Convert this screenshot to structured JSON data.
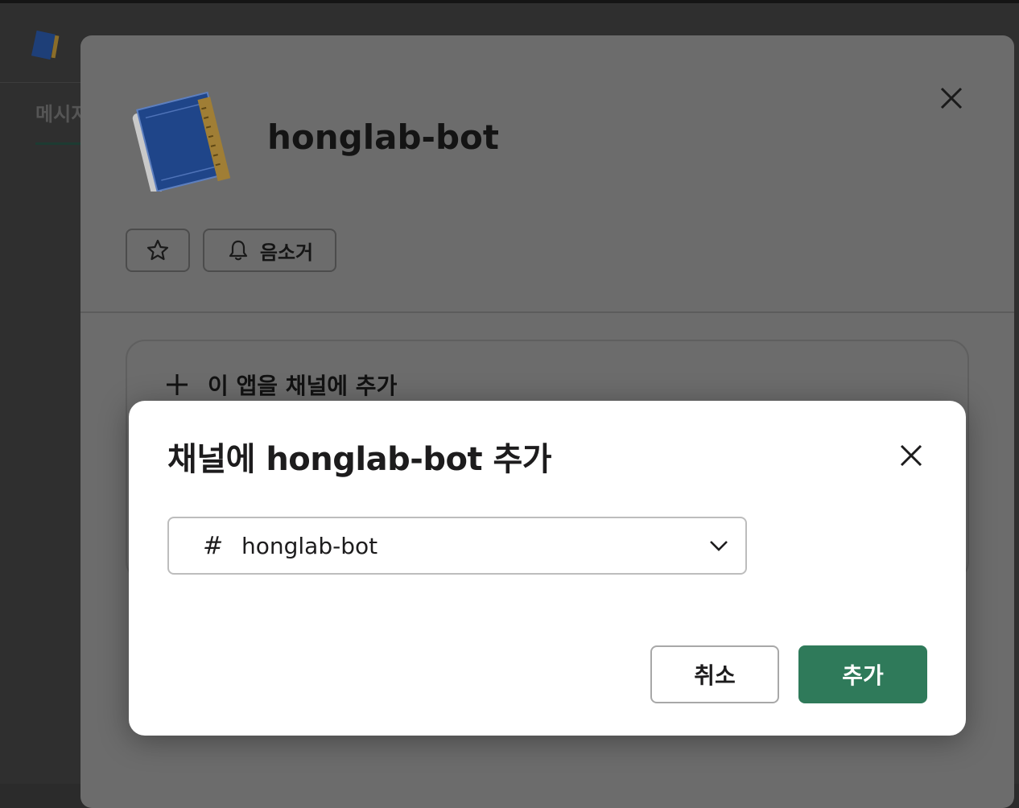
{
  "background": {
    "tab_label": "메시지"
  },
  "app_panel": {
    "app_name": "honglab-bot",
    "star_icon": "star-icon",
    "mute_label": "음소거",
    "add_to_channel_label": "이 앱을 채널에 추가"
  },
  "dialog": {
    "title": "채널에 honglab-bot 추가",
    "channel_prefix": "#",
    "channel_value": "honglab-bot",
    "cancel_label": "취소",
    "add_label": "추가"
  },
  "colors": {
    "primary_button": "#2f7a5a",
    "dialog_background": "#ffffff",
    "overlay_panel": "#6c6c6c"
  }
}
